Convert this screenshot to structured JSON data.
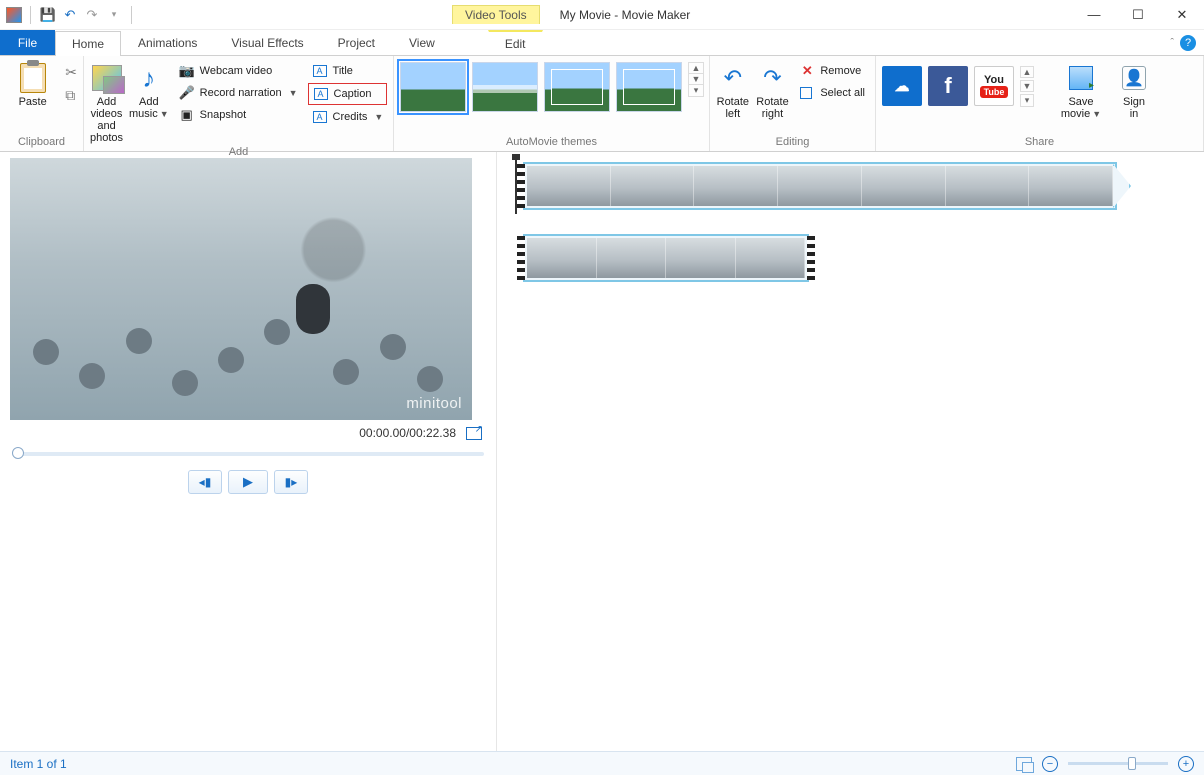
{
  "window": {
    "title": "My Movie - Movie Maker",
    "context_group": "Video Tools",
    "context_tab": "Edit"
  },
  "qat": {
    "undo_tip": "Undo",
    "redo_tip": "Redo",
    "save_tip": "Save"
  },
  "tabs": {
    "file": "File",
    "home": "Home",
    "animations": "Animations",
    "visual_effects": "Visual Effects",
    "project": "Project",
    "view": "View"
  },
  "ribbon": {
    "clipboard": {
      "label": "Clipboard",
      "paste": "Paste"
    },
    "add": {
      "label": "Add",
      "add_videos": "Add videos\nand photos",
      "add_music": "Add\nmusic",
      "webcam": "Webcam video",
      "record": "Record narration",
      "snapshot": "Snapshot",
      "title": "Title",
      "caption": "Caption",
      "credits": "Credits"
    },
    "themes": {
      "label": "AutoMovie themes"
    },
    "editing": {
      "label": "Editing",
      "rotate_left": "Rotate\nleft",
      "rotate_right": "Rotate\nright",
      "remove": "Remove",
      "select_all": "Select all"
    },
    "share": {
      "label": "Share",
      "save_movie": "Save\nmovie",
      "sign_in": "Sign\nin",
      "youtube_top": "You",
      "youtube_bottom": "Tube"
    }
  },
  "preview": {
    "watermark": "minitool",
    "time": "00:00.00/00:22.38"
  },
  "status": {
    "item": "Item 1 of 1"
  }
}
